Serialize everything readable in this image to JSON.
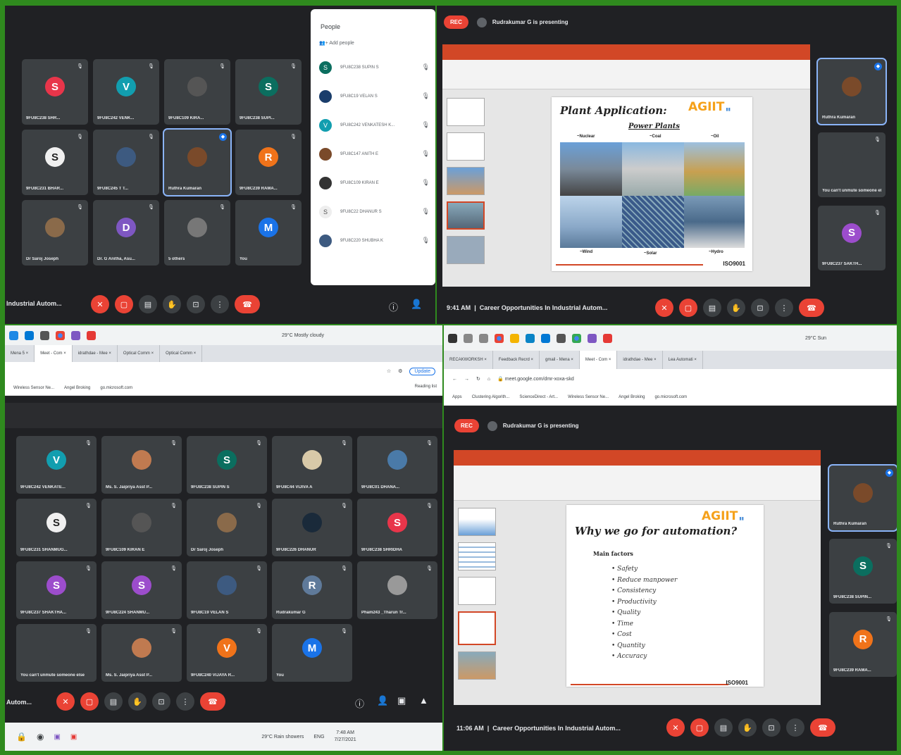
{
  "q1": {
    "tiles": [
      {
        "initial": "S",
        "color": "#e8354a",
        "name": "9FU8C238 SHR..."
      },
      {
        "initial": "V",
        "color": "#129eaf",
        "name": "9FU8C242 VENK..."
      },
      {
        "initial": "",
        "color": "#555",
        "name": "9FU8C109 KIRA..."
      },
      {
        "initial": "S",
        "color": "#0b6e5f",
        "name": "9FU8C238 SUPI..."
      },
      {
        "initial": "S",
        "color": "#f0f0f0",
        "name": "9FU8C231 BHAR..."
      },
      {
        "initial": "",
        "color": "#3d5a80",
        "name": "9FU8C245 T T..."
      },
      {
        "initial": "",
        "color": "#7a4a2a",
        "name": "Ruthra Kumaran",
        "active": true
      },
      {
        "initial": "R",
        "color": "#f0731a",
        "name": "9FU8C239 RAMA..."
      },
      {
        "initial": "",
        "color": "#8a6a4a",
        "name": "Dr Saroj Joseph"
      },
      {
        "initial": "D",
        "color": "#7e57c2",
        "name": "Dr. G Anitha, Asu..."
      },
      {
        "initial": "",
        "color": "#777",
        "name": "5 others"
      },
      {
        "initial": "M",
        "color": "#1a73e8",
        "name": "You"
      }
    ],
    "meeting_title": "Industrial Autom...",
    "people": {
      "title": "People",
      "add": "Add people",
      "list": [
        {
          "initial": "S",
          "color": "#0b6e5f",
          "name": "9FU8C238 SUPIN S"
        },
        {
          "initial": "",
          "color": "#1a3d6b",
          "name": "9FU8C19 VELAN S"
        },
        {
          "initial": "V",
          "color": "#129eaf",
          "name": "9FU8C242 VENKATESH K..."
        },
        {
          "initial": "",
          "color": "#7a4a2a",
          "name": "9FU8C147 ANITH E"
        },
        {
          "initial": "",
          "color": "#333",
          "name": "9FU8C109 KIRAN E"
        },
        {
          "initial": "S",
          "color": "#eee",
          "name": "9FU8C22 DHANUR S"
        },
        {
          "initial": "",
          "color": "#3d5a80",
          "name": "9FU8C220 SHUBHA K"
        }
      ]
    }
  },
  "q2": {
    "rec": "REC",
    "presenting": "Rudrakumar G is presenting",
    "slide_title": "Plant Application:",
    "slide_sub": "Power Plants",
    "labels": [
      "~Nuclear",
      "~Coal",
      "~Oil",
      "~Wind",
      "~Solar",
      "~Hydro"
    ],
    "logo": "AGIIT",
    "iso": "ISO9001",
    "time": "9:41 AM",
    "meeting": "Career Opportunities In Industrial Autom...",
    "side": [
      {
        "initial": "",
        "color": "#7a4a2a",
        "name": "Ruthra Kumaran",
        "active": true
      },
      {
        "initial": "",
        "color": "#3c4043",
        "name": "You can't unmute someone else"
      },
      {
        "initial": "S",
        "color": "#9c4dcc",
        "name": "9FU8C237 SAKTH..."
      }
    ]
  },
  "q3": {
    "taskbar_weather": "29°C  Mostly cloudy",
    "tabs": [
      "Mena 5 ×",
      "Meet - Com ×",
      "idrathdae - Mee ×",
      "Optical Comm ×",
      "Optical Comm ×"
    ],
    "update": "Update",
    "reading_list": "Reading list",
    "bookmarks": [
      "Wireless Sensor Ne...",
      "Angel Broking",
      "go.microsoft.com"
    ],
    "tiles": [
      {
        "initial": "V",
        "color": "#129eaf",
        "name": "9FU8C242 VENKATE..."
      },
      {
        "initial": "",
        "color": "#c07a50",
        "name": "Ms. S. Jaipriya Asst P..."
      },
      {
        "initial": "S",
        "color": "#0b6e5f",
        "name": "9FU8C238 SUPIN S"
      },
      {
        "initial": "",
        "color": "#d8c9a8",
        "name": "9FU8C44 VIJIVA A"
      },
      {
        "initial": "",
        "color": "#4a7aa8",
        "name": "9FU8C01 DHANA..."
      },
      {
        "initial": "S",
        "color": "#f0f0f0",
        "name": "9FU8C231 SHANMUG..."
      },
      {
        "initial": "",
        "color": "#555",
        "name": "9FU8C109 KIRAN E"
      },
      {
        "initial": "",
        "color": "#8a6a4a",
        "name": "Dr Saroj Joseph"
      },
      {
        "initial": "",
        "color": "#1a2a3a",
        "name": "9FU8C226 DHANUR"
      },
      {
        "initial": "S",
        "color": "#e8354a",
        "name": "9FU8C238 SHRIDHA"
      },
      {
        "initial": "S",
        "color": "#9c4dcc",
        "name": "9FU8C237 SHAKTHA..."
      },
      {
        "initial": "S",
        "color": "#9c4dcc",
        "name": "9FU8C224 SHANMU..."
      },
      {
        "initial": "",
        "color": "#3d5a80",
        "name": "9FU8C19 VELAN S"
      },
      {
        "initial": "R",
        "color": "#5f7a9a",
        "name": "Rudrakumar G"
      },
      {
        "initial": "",
        "color": "#999",
        "name": "Pham243 _Tharun Tr..."
      },
      {
        "initial": "",
        "color": "#3c4043",
        "name": "You can't unmute someone else"
      },
      {
        "initial": "",
        "color": "#c07a50",
        "name": "Ms. S. Jaipriya Asst P..."
      },
      {
        "initial": "V",
        "color": "#f0731a",
        "name": "9FU8C240 VIJAYA R..."
      },
      {
        "initial": "M",
        "color": "#1a73e8",
        "name": "You"
      }
    ],
    "meeting_title": "Autom...",
    "clock": "7:48 AM",
    "date": "7/27/2021",
    "lang": "ENG",
    "weather2": "29°C  Rain showers"
  },
  "q4": {
    "taskbar_weather": "29°C Sun",
    "tabs": [
      "RECAKWORKSH ×",
      "Feedback Recrd ×",
      "gmail - Mena ×",
      "Meet - Com ×",
      "idrathdae - Mee ×",
      "Lea Automati ×"
    ],
    "url": "meet.google.com/dmr-xoxa-skd",
    "bookmarks": [
      "Apps",
      "Clustering Algorith...",
      "ScienceDirect - Art...",
      "Wireless Sensor Ne...",
      "Angel Broking",
      "go.microsoft.com"
    ],
    "rec": "REC",
    "presenting": "Rudrakumar G is presenting",
    "slide_title": "Why we go for automation?",
    "slide_sub": "Main factors",
    "bullets": [
      "Safety",
      "Reduce manpower",
      "Consistency",
      "Productivity",
      "Quality",
      "Time",
      "Cost",
      "Quantity",
      "Accuracy"
    ],
    "logo": "AGIIT",
    "iso": "ISO9001",
    "time": "11:06 AM",
    "meeting": "Career Opportunities In Industrial Autom...",
    "side": [
      {
        "initial": "",
        "color": "#7a4a2a",
        "name": "Ruthra Kumaran",
        "active": true
      },
      {
        "initial": "S",
        "color": "#0b6e5f",
        "name": "9FU8C238 SUPIN..."
      },
      {
        "initial": "R",
        "color": "#f0731a",
        "name": "9FU8C239 RAMA..."
      }
    ]
  }
}
